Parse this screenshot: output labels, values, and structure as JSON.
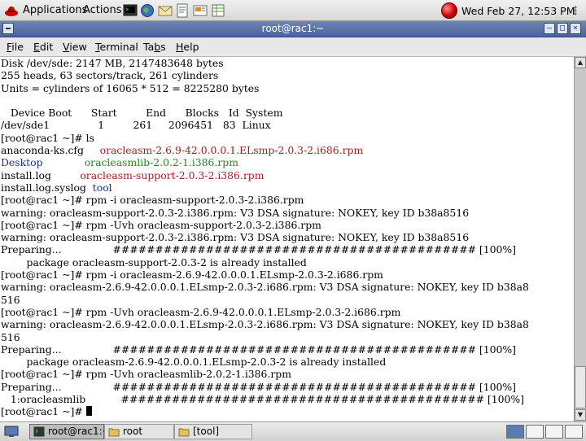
{
  "top_panel": {
    "applications_label": "Applications",
    "actions_label": "Actions",
    "launchers": [
      "terminal-icon",
      "browser-icon",
      "email-icon",
      "writer-icon",
      "impress-icon",
      "calc-icon"
    ],
    "clock": "Wed Feb 27, 12:53 PM",
    "alert_color": "#d00000"
  },
  "window": {
    "title": "root@rac1:~",
    "buttons": {
      "minimize": "–",
      "maximize": "□",
      "close": "×"
    },
    "menus": [
      {
        "key": "F",
        "rest": "ile"
      },
      {
        "key": "E",
        "rest": "dit"
      },
      {
        "key": "V",
        "rest": "iew"
      },
      {
        "key": "T",
        "rest": "erminal"
      },
      {
        "pre": "Ta",
        "key": "b",
        "rest": "s"
      },
      {
        "key": "H",
        "rest": "elp"
      }
    ]
  },
  "terminal": {
    "lines": [
      [
        {
          "t": "Disk /dev/sde: 2147 MB, 2147483648 bytes"
        }
      ],
      [
        {
          "t": "255 heads, 63 sectors/track, 261 cylinders"
        }
      ],
      [
        {
          "t": "Units = cylinders of 16065 * 512 = 8225280 bytes"
        }
      ],
      [
        {
          "t": ""
        }
      ],
      [
        {
          "t": "   Device Boot      Start         End      Blocks   Id  System"
        }
      ],
      [
        {
          "t": "/dev/sde1               1         261     2096451   83  Linux"
        }
      ],
      [
        {
          "t": "[root@rac1 ~]# ls"
        }
      ],
      [
        {
          "t": "anaconda-ks.cfg     "
        },
        {
          "t": "oracleasm-2.6.9-42.0.0.0.1.ELsmp-2.0.3-2.i686.rpm",
          "c": "rpm"
        }
      ],
      [
        {
          "t": "Desktop",
          "c": "dir"
        },
        {
          "t": "             "
        },
        {
          "t": "oracleasmlib-2.0.2-1.i386.rpm",
          "c": "exe"
        }
      ],
      [
        {
          "t": "install.log         "
        },
        {
          "t": "oracleasm-support-2.0.3-2.i386.rpm",
          "c": "rpm"
        }
      ],
      [
        {
          "t": "install.log.syslog  "
        },
        {
          "t": "tool",
          "c": "dir"
        }
      ],
      [
        {
          "t": "[root@rac1 ~]# rpm -i oracleasm-support-2.0.3-2.i386.rpm"
        }
      ],
      [
        {
          "t": "warning: oracleasm-support-2.0.3-2.i386.rpm: V3 DSA signature: NOKEY, key ID b38a8516"
        }
      ],
      [
        {
          "t": "[root@rac1 ~]# rpm -Uvh oracleasm-support-2.0.3-2.i386.rpm"
        }
      ],
      [
        {
          "t": "warning: oracleasm-support-2.0.3-2.i386.rpm: V3 DSA signature: NOKEY, key ID b38a8516"
        }
      ],
      [
        {
          "t": "Preparing...                ########################################### [100%]"
        }
      ],
      [
        {
          "t": "        package oracleasm-support-2.0.3-2 is already installed"
        }
      ],
      [
        {
          "t": "[root@rac1 ~]# rpm -i oracleasm-2.6.9-42.0.0.0.1.ELsmp-2.0.3-2.i686.rpm"
        }
      ],
      [
        {
          "t": "warning: oracleasm-2.6.9-42.0.0.0.1.ELsmp-2.0.3-2.i686.rpm: V3 DSA signature: NOKEY, key ID b38a8"
        }
      ],
      [
        {
          "t": "516"
        }
      ],
      [
        {
          "t": "[root@rac1 ~]# rpm -Uvh oracleasm-2.6.9-42.0.0.0.1.ELsmp-2.0.3-2.i686.rpm"
        }
      ],
      [
        {
          "t": "warning: oracleasm-2.6.9-42.0.0.0.1.ELsmp-2.0.3-2.i686.rpm: V3 DSA signature: NOKEY, key ID b38a8"
        }
      ],
      [
        {
          "t": "516"
        }
      ],
      [
        {
          "t": "Preparing...                ########################################### [100%]"
        }
      ],
      [
        {
          "t": "        package oracleasm-2.6.9-42.0.0.0.1.ELsmp-2.0.3-2 is already installed"
        }
      ],
      [
        {
          "t": "[root@rac1 ~]# rpm -Uvh oracleasmlib-2.0.2-1.i386.rpm"
        }
      ],
      [
        {
          "t": "Preparing...                ########################################### [100%]"
        }
      ],
      [
        {
          "t": "   1:oracleasmlib           ########################################### [100%]"
        }
      ],
      [
        {
          "t": "[root@rac1 ~]# "
        },
        {
          "cursor": true
        }
      ]
    ]
  },
  "taskbar": {
    "tasks": [
      {
        "label": "root@rac1:~",
        "icon": "terminal-icon",
        "active": true
      },
      {
        "label": "root",
        "icon": "folder-icon",
        "active": false
      },
      {
        "label": "[tool]",
        "icon": "folder-icon",
        "active": false
      }
    ],
    "workspaces": [
      true,
      false,
      false,
      false
    ]
  },
  "colors": {
    "rpm_file": "#a51d1d",
    "directory": "#1a2e8f",
    "executable": "#1f8a1f",
    "titlebar": "#4b6398"
  }
}
